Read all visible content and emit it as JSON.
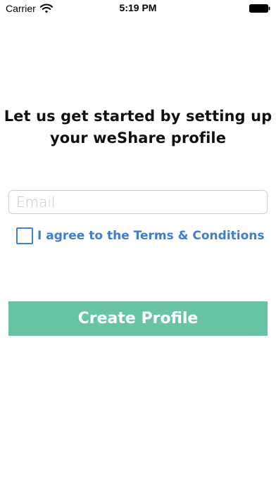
{
  "status_bar": {
    "carrier": "Carrier",
    "time": "5:19 PM",
    "icons": [
      "wifi-icon",
      "battery-icon"
    ]
  },
  "form": {
    "heading_line1": "Let us get started by setting up",
    "heading_line2": "your weShare profile",
    "email_placeholder": "Email",
    "email_value": "",
    "terms_label": "I agree to the Terms & Conditions",
    "terms_checked": false,
    "create_button_label": "Create Profile"
  },
  "colors": {
    "button_bg": "#67c5a4",
    "link_blue": "#3b7dd8",
    "checkbox_border": "#3b82e0"
  }
}
